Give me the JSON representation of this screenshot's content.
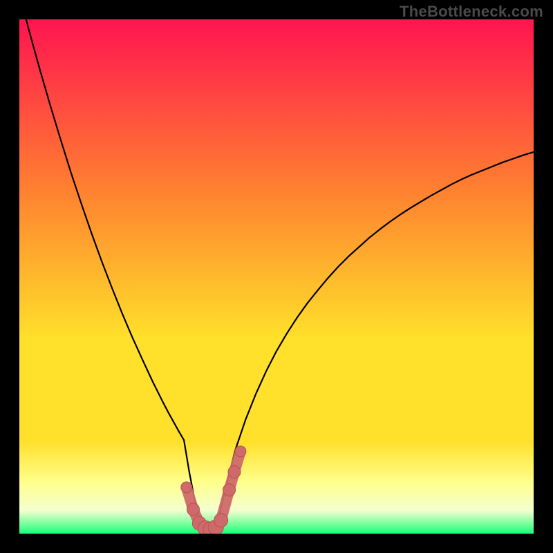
{
  "watermark": "TheBottleneck.com",
  "colors": {
    "page_bg": "#000000",
    "curve": "#000000",
    "marker_fill": "#cf6a6a",
    "marker_stroke": "#b94f4f",
    "grad_top": "#ff1450",
    "grad_mid_upper": "#ff8030",
    "grad_mid": "#ffe02a",
    "grad_soft_yellow": "#ffff8c",
    "grad_pale": "#f4ffcf",
    "grad_green": "#19ff77"
  },
  "chart_data": {
    "type": "line",
    "title": "",
    "xlabel": "",
    "ylabel": "",
    "xlim": [
      0,
      100
    ],
    "ylim": [
      0,
      100
    ],
    "x": [
      0,
      2,
      4,
      6,
      8,
      10,
      12,
      14,
      16,
      18,
      20,
      22,
      24,
      26,
      28,
      29,
      30,
      31,
      32,
      33,
      34,
      35,
      36,
      37,
      38,
      39,
      40,
      42,
      44,
      46,
      48,
      50,
      52,
      54,
      56,
      58,
      60,
      62,
      64,
      66,
      68,
      70,
      72,
      74,
      76,
      78,
      80,
      82,
      84,
      86,
      88,
      90,
      92,
      94,
      96,
      98,
      100
    ],
    "y": [
      105,
      97.4,
      90.2,
      83.3,
      76.7,
      70.3,
      64.3,
      58.5,
      53.0,
      47.8,
      42.8,
      38.1,
      33.7,
      29.4,
      25.4,
      23.5,
      21.7,
      19.9,
      18.2,
      12.2,
      7.0,
      3.0,
      1.0,
      0.8,
      1.0,
      4.0,
      8.5,
      16.3,
      22.2,
      27.2,
      31.6,
      35.5,
      38.9,
      42.0,
      44.8,
      47.3,
      49.7,
      51.9,
      53.9,
      55.7,
      57.5,
      59.1,
      60.6,
      62.0,
      63.3,
      64.5,
      65.7,
      66.8,
      67.9,
      68.9,
      69.8,
      70.6,
      71.4,
      72.2,
      72.9,
      73.6,
      74.2
    ],
    "markers": {
      "x": [
        32.5,
        33.8,
        35.0,
        36.2,
        37.2,
        38.2,
        39.2,
        40.8,
        41.8,
        43.0
      ],
      "y": [
        9.0,
        4.7,
        2.0,
        1.0,
        0.8,
        1.2,
        2.6,
        8.5,
        12.0,
        16.0
      ],
      "size": [
        8,
        9,
        10,
        11,
        11,
        11,
        10,
        9,
        9,
        8
      ]
    }
  }
}
